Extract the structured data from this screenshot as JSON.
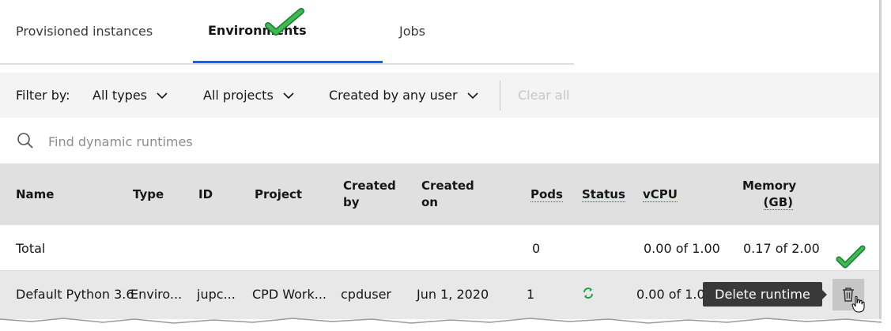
{
  "tabs": [
    {
      "label": "Provisioned instances",
      "active": false
    },
    {
      "label": "Environments",
      "active": true
    },
    {
      "label": "Jobs",
      "active": false
    }
  ],
  "filter": {
    "label": "Filter by:",
    "types": "All types",
    "projects": "All projects",
    "user": "Created by any user",
    "clear": "Clear all"
  },
  "search": {
    "placeholder": "Find dynamic runtimes"
  },
  "table": {
    "headers": {
      "name": "Name",
      "type": "Type",
      "id": "ID",
      "project": "Project",
      "created_by_1": "Created",
      "created_by_2": "by",
      "created_on_1": "Created",
      "created_on_2": "on",
      "pods": "Pods",
      "status": "Status",
      "vcpu": "vCPU",
      "memory_1": "Memory",
      "memory_2": "(GB)"
    },
    "total": {
      "name": "Total",
      "pods": "0",
      "vcpu": "0.00 of 1.00",
      "memory": "0.17 of 2.00"
    },
    "row": {
      "name": "Default Python 3.6",
      "type": "Enviro...",
      "id": "jupc...",
      "project": "CPD Work...",
      "created_by": "cpduser",
      "created_on": "Jun 1, 2020",
      "pods": "1",
      "status_icon": "sync-icon",
      "vcpu": "0.00 of 1.0"
    },
    "tooltip": "Delete runtime",
    "delete_icon": "trash-icon"
  },
  "colors": {
    "accent": "#0f62fe",
    "check": "#24a148",
    "status": "#24a148"
  }
}
